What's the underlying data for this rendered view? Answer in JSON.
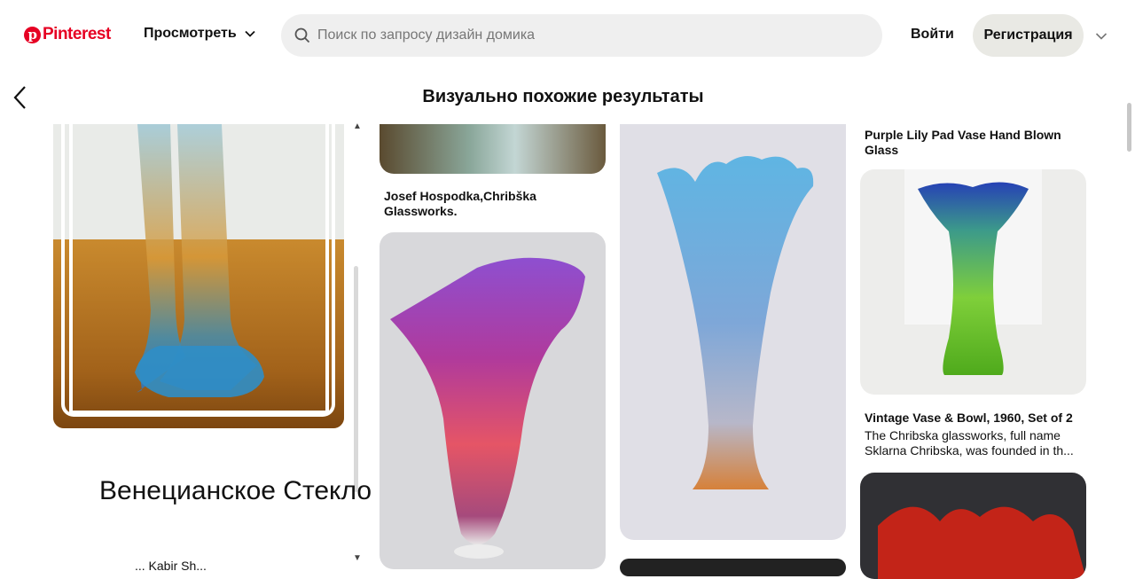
{
  "header": {
    "logo_text": "Pinterest",
    "browse_label": "Просмотреть",
    "search_placeholder": "Поиск по запросу дизайн домика",
    "login_label": "Войти",
    "signup_label": "Регистрация"
  },
  "section_title": "Визуально похожие результаты",
  "left_pin": {
    "title": "Венецианское Стекло",
    "subtitle": "... Kabir Sh..."
  },
  "pins": [
    {
      "caption": "Josef Hospodka,Chribška Glassworks."
    },
    {
      "caption": "Purple Lily Pad Vase Hand Blown Glass"
    },
    {
      "caption": "Vintage Vase & Bowl, 1960, Set of 2",
      "description": "The Chribska glassworks, full name Sklarna Chribska, was founded in th..."
    }
  ],
  "colors": {
    "brand": "#e60023",
    "signup_bg": "#e9e9e4",
    "search_bg": "#efefef"
  }
}
